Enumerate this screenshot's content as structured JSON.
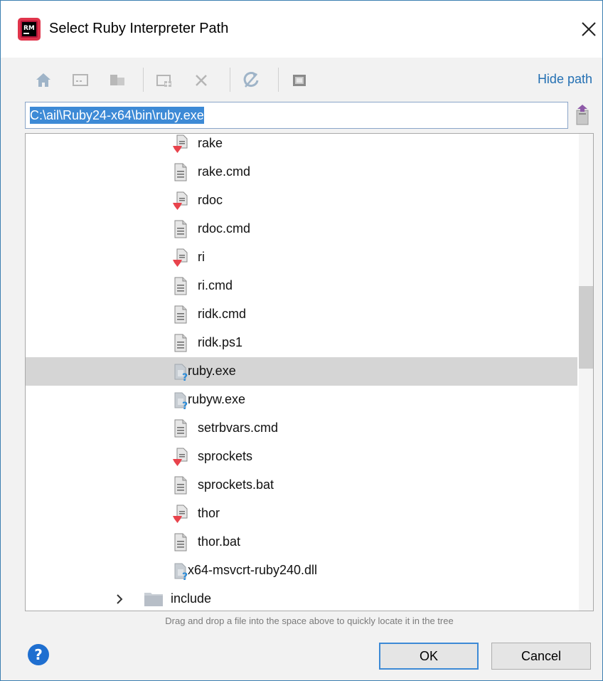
{
  "window": {
    "title": "Select Ruby Interpreter Path"
  },
  "toolbar": {
    "buttons": [
      "home-icon",
      "desktop-icon",
      "project-icon",
      "new-folder-icon",
      "delete-icon",
      "refresh-icon",
      "show-hidden-icon"
    ],
    "hide_path_label": "Hide path"
  },
  "path": {
    "value": "C:\\ail\\Ruby24-x64\\bin\\ruby.exe"
  },
  "tree": {
    "items": [
      {
        "label": "rake",
        "icon": "ruby-script-icon"
      },
      {
        "label": "rake.cmd",
        "icon": "text-file-icon"
      },
      {
        "label": "rdoc",
        "icon": "ruby-script-icon"
      },
      {
        "label": "rdoc.cmd",
        "icon": "text-file-icon"
      },
      {
        "label": "ri",
        "icon": "ruby-script-icon"
      },
      {
        "label": "ri.cmd",
        "icon": "text-file-icon"
      },
      {
        "label": "ridk.cmd",
        "icon": "text-file-icon"
      },
      {
        "label": "ridk.ps1",
        "icon": "text-file-icon"
      },
      {
        "label": "ruby.exe",
        "icon": "unknown-file-icon",
        "selected": true
      },
      {
        "label": "rubyw.exe",
        "icon": "unknown-file-icon"
      },
      {
        "label": "setrbvars.cmd",
        "icon": "text-file-icon"
      },
      {
        "label": "sprockets",
        "icon": "ruby-script-icon"
      },
      {
        "label": "sprockets.bat",
        "icon": "text-file-icon"
      },
      {
        "label": "thor",
        "icon": "ruby-script-icon"
      },
      {
        "label": "thor.bat",
        "icon": "text-file-icon"
      },
      {
        "label": "x64-msvcrt-ruby240.dll",
        "icon": "unknown-file-icon"
      }
    ],
    "folder": {
      "label": "include",
      "icon": "folder-icon",
      "expanded": false
    }
  },
  "hint": "Drag and drop a file into the space above to quickly locate it in the tree",
  "footer": {
    "ok_label": "OK",
    "cancel_label": "Cancel",
    "help_label": "?"
  },
  "colors": {
    "accent": "#3d8ad6",
    "link": "#2470b3",
    "selection": "#d5d5d5",
    "ruby": "#e8434c"
  }
}
